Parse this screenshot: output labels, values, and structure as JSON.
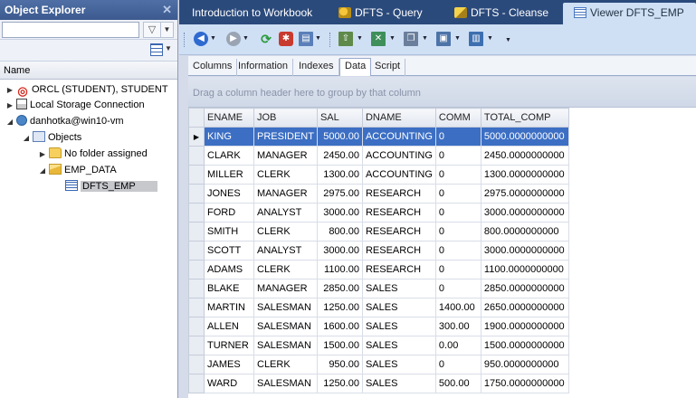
{
  "explorer": {
    "title": "Object Explorer",
    "close_glyph": "✕",
    "search_placeholder": "",
    "column_header": "Name",
    "tree": [
      {
        "label": "ORCL (STUDENT), STUDENT",
        "icon": "oracle-icon",
        "arrow": "▶"
      },
      {
        "label": "Local Storage Connection",
        "icon": "storage-icon",
        "arrow": "▶"
      },
      {
        "label": "danhotka@win10-vm",
        "icon": "user-icon",
        "arrow": "◢"
      },
      {
        "label": "Objects",
        "icon": "objects-icon",
        "arrow": "◢"
      },
      {
        "label": "No folder assigned",
        "icon": "folder-icon",
        "arrow": "▶"
      },
      {
        "label": "EMP_DATA",
        "icon": "folder-open-icon",
        "arrow": "◢"
      },
      {
        "label": "DFTS_EMP",
        "icon": "table-icon",
        "arrow": ""
      }
    ]
  },
  "tabs": [
    {
      "label": "Introduction to Workbook",
      "icon": ""
    },
    {
      "label": "DFTS - Query",
      "icon": "query-icon"
    },
    {
      "label": "DFTS - Cleanse",
      "icon": "cleanse-icon"
    },
    {
      "label": "Viewer DFTS_EMP",
      "icon": "viewer-icon",
      "active": true
    }
  ],
  "sub_tabs": [
    "Columns",
    "Information",
    "Indexes",
    "Data",
    "Script"
  ],
  "active_sub_tab": "Data",
  "group_panel_text": "Drag a column header here to group by that column",
  "grid": {
    "columns": [
      "ENAME",
      "JOB",
      "SAL",
      "DNAME",
      "COMM",
      "TOTAL_COMP"
    ],
    "row_indicator": "▶",
    "rows": [
      [
        "KING",
        "PRESIDENT",
        "5000.00",
        "ACCOUNTING",
        "0",
        "5000.0000000000"
      ],
      [
        "CLARK",
        "MANAGER",
        "2450.00",
        "ACCOUNTING",
        "0",
        "2450.0000000000"
      ],
      [
        "MILLER",
        "CLERK",
        "1300.00",
        "ACCOUNTING",
        "0",
        "1300.0000000000"
      ],
      [
        "JONES",
        "MANAGER",
        "2975.00",
        "RESEARCH",
        "0",
        "2975.0000000000"
      ],
      [
        "FORD",
        "ANALYST",
        "3000.00",
        "RESEARCH",
        "0",
        "3000.0000000000"
      ],
      [
        "SMITH",
        "CLERK",
        "800.00",
        "RESEARCH",
        "0",
        "800.0000000000"
      ],
      [
        "SCOTT",
        "ANALYST",
        "3000.00",
        "RESEARCH",
        "0",
        "3000.0000000000"
      ],
      [
        "ADAMS",
        "CLERK",
        "1100.00",
        "RESEARCH",
        "0",
        "1100.0000000000"
      ],
      [
        "BLAKE",
        "MANAGER",
        "2850.00",
        "SALES",
        "0",
        "2850.0000000000"
      ],
      [
        "MARTIN",
        "SALESMAN",
        "1250.00",
        "SALES",
        "1400.00",
        "2650.0000000000"
      ],
      [
        "ALLEN",
        "SALESMAN",
        "1600.00",
        "SALES",
        "300.00",
        "1900.0000000000"
      ],
      [
        "TURNER",
        "SALESMAN",
        "1500.00",
        "SALES",
        "0.00",
        "1500.0000000000"
      ],
      [
        "JAMES",
        "CLERK",
        "950.00",
        "SALES",
        "0",
        "950.0000000000"
      ],
      [
        "WARD",
        "SALESMAN",
        "1250.00",
        "SALES",
        "500.00",
        "1750.0000000000"
      ]
    ]
  },
  "colors": {
    "title_bar": "#3c5a8e",
    "tabs_bar": "#2b4a7c",
    "selected_row": "#3c6fc4",
    "active_tab": "#cfe0f5"
  }
}
